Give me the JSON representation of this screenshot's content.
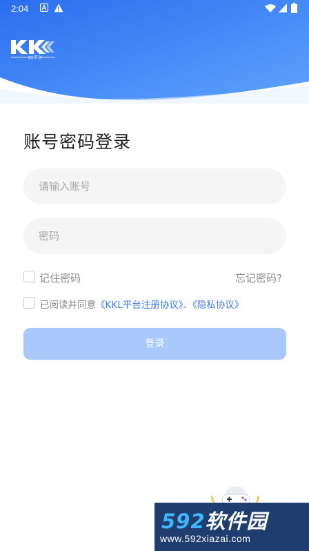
{
  "status_bar": {
    "time": "2:04",
    "icons": [
      "a-icon",
      "warning-icon",
      "wifi-icon",
      "signal-icon",
      "battery-icon"
    ]
  },
  "header": {
    "logo_text": "KK",
    "logo_subtext": "KK平台",
    "colors": {
      "gradient_start": "#2f75f0",
      "gradient_end": "#5aa0fa",
      "wave": "#ffffff"
    }
  },
  "login": {
    "title": "账号密码登录",
    "account_placeholder": "请输入账号",
    "password_placeholder": "密码",
    "remember_label": "记住密码",
    "forgot_label": "忘记密码?",
    "agree_prefix": "已阅读并同意",
    "agreement_link": "《KKL平台注册协议》",
    "separator": "、",
    "privacy_link": "《隐私协议》",
    "login_button": "登录",
    "accent_color": "#3f7fe8",
    "button_color": "#a9c8fb"
  },
  "watermark": {
    "brand_num": "592",
    "brand_text": "软件园",
    "url": "www.592xiazai.com"
  }
}
